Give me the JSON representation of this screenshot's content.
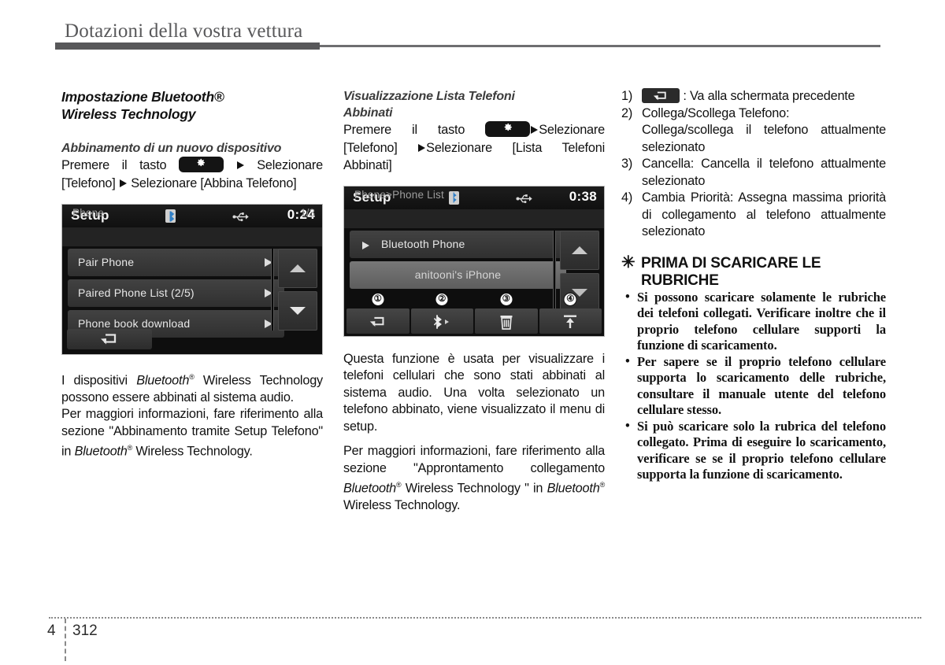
{
  "header": {
    "chapter_title": "Dotazioni della vostra vettura"
  },
  "footer": {
    "chapter_number": "4",
    "page_number": "312"
  },
  "left_column": {
    "section_title_line1": "Impostazione Bluetooth®",
    "section_title_line2": "Wireless Technology",
    "sub_title": "Abbinamento di un nuovo dispositivo",
    "instruction_prefix": "Premere il tasto",
    "instruction_after_button": "Selezionare [Telefono]",
    "instruction_tail": "Selezionare [Abbina Telefono]",
    "paragraph_1_pre": "I dispositivi ",
    "paragraph_1_em": "Bluetooth",
    "paragraph_1_post": " Wireless Technology possono essere abbinati al sistema audio.",
    "paragraph_2_pre": "Per maggiori informazioni, fare riferimento alla sezione \"Abbinamento tramite Setup Telefono\" in ",
    "paragraph_2_em": "Bluetooth",
    "paragraph_2_post": " Wireless Technology.",
    "screenshot": {
      "title": "Setup",
      "clock": "0:24",
      "breadcrumb": "Phone",
      "page_indicator": "1/3",
      "bluetooth_icon": "bluetooth-icon",
      "usb_icon": "usb-icon",
      "rows": [
        {
          "label": "Pair Phone",
          "arrow": "chevron-right-icon"
        },
        {
          "label": "Paired Phone List  (2/5)",
          "arrow": "chevron-right-icon"
        },
        {
          "label": "Phone book download",
          "arrow": "chevron-right-icon"
        }
      ],
      "scroll_up_icon": "triangle-up-icon",
      "scroll_down_icon": "triangle-down-icon",
      "back_button_icon": "return-arrow-icon"
    }
  },
  "middle_column": {
    "section_title_line1": "Visualizzazione Lista Telefoni",
    "section_title_line2": "Abbinati",
    "instruction_prefix": "Premere il tasto",
    "instruction_after_button": "Selezionare [Telefono]",
    "instruction_tail": "Selezionare [Lista Telefoni Abbinati]",
    "paragraph_1": "Questa funzione è usata per visualizzare i telefoni cellulari che sono stati abbinati al sistema audio. Una volta selezionato un telefono abbinato, viene visualizzato il menu di setup.",
    "paragraph_2_pre": "Per maggiori informazioni, fare riferimento alla sezione \"Approntamento collegamento ",
    "paragraph_2_em1": "Bluetooth",
    "paragraph_2_mid": " Wireless Technology \" in ",
    "paragraph_2_em2": "Bluetooth",
    "paragraph_2_post": " Wireless Technology.",
    "screenshot": {
      "title": "Setup",
      "clock": "0:38",
      "breadcrumb": "Phone>Phone List",
      "bluetooth_icon": "bluetooth-icon",
      "usb_icon": "usb-icon",
      "rows": [
        {
          "label": "Bluetooth Phone",
          "selected": false,
          "lead_icon": "triangle-right-icon"
        },
        {
          "label": "anitooni's iPhone",
          "selected": true,
          "lead_icon": ""
        }
      ],
      "scroll_up_icon": "triangle-up-icon",
      "scroll_down_icon": "triangle-down-icon",
      "toolbar": [
        {
          "callout": "①",
          "icon": "return-arrow-icon"
        },
        {
          "callout": "②",
          "icon": "bluetooth-connect-icon"
        },
        {
          "callout": "③",
          "icon": "trash-icon"
        },
        {
          "callout": "④",
          "icon": "priority-up-icon"
        }
      ]
    }
  },
  "right_column": {
    "numbered_items": [
      {
        "num": "1)",
        "icon": "return-arrow-icon",
        "text": ": Va alla schermata precedente"
      },
      {
        "num": "2)",
        "text": "Collega/Scollega Telefono:",
        "detail": "Collega/scollega il telefono attualmente selezionato"
      },
      {
        "num": "3)",
        "text": "Cancella: Cancella il telefono attualmente selezionato"
      },
      {
        "num": "4)",
        "text": "Cambia Priorità: Assegna massima priorità di collegamento al telefono attualmente selezionato"
      }
    ],
    "notice": {
      "asterisk": "✳",
      "title": "PRIMA DI SCARICARE LE RUBRICHE",
      "bullets": [
        "Si possono scaricare solamente le rubriche dei telefoni collegati. Verificare inoltre che il proprio telefono cellulare supporti la funzione di scaricamento.",
        "Per sapere se il proprio telefono cellulare supporta lo scaricamento delle rubriche, consultare il manuale utente del telefono cellulare stesso.",
        "Si può scaricare solo la rubrica del telefono collegato. Prima di eseguire lo scaricamento, verificare se se il proprio telefono cellulare supporta la funzione di scaricamento."
      ]
    }
  }
}
